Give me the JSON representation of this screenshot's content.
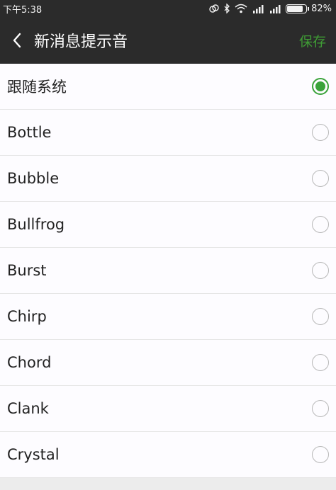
{
  "status_bar": {
    "time": "下午5:38",
    "battery_percent": "82%",
    "battery_level": 0.82,
    "icons": [
      "sync-icon",
      "bluetooth-icon",
      "wifi-icon",
      "signal-icon",
      "signal-icon",
      "battery-icon"
    ]
  },
  "nav": {
    "title": "新消息提示音",
    "save_label": "保存",
    "back_icon": "chevron-left-icon"
  },
  "options": [
    {
      "label": "跟随系统",
      "selected": true
    },
    {
      "label": "Bottle",
      "selected": false
    },
    {
      "label": "Bubble",
      "selected": false
    },
    {
      "label": "Bullfrog",
      "selected": false
    },
    {
      "label": "Burst",
      "selected": false
    },
    {
      "label": "Chirp",
      "selected": false
    },
    {
      "label": "Chord",
      "selected": false
    },
    {
      "label": "Clank",
      "selected": false
    },
    {
      "label": "Crystal",
      "selected": false
    }
  ],
  "colors": {
    "accent": "#3aa33a",
    "save": "#3f9c35",
    "header_bg": "#2b2b2b",
    "row_bg": "#fdfcff"
  }
}
